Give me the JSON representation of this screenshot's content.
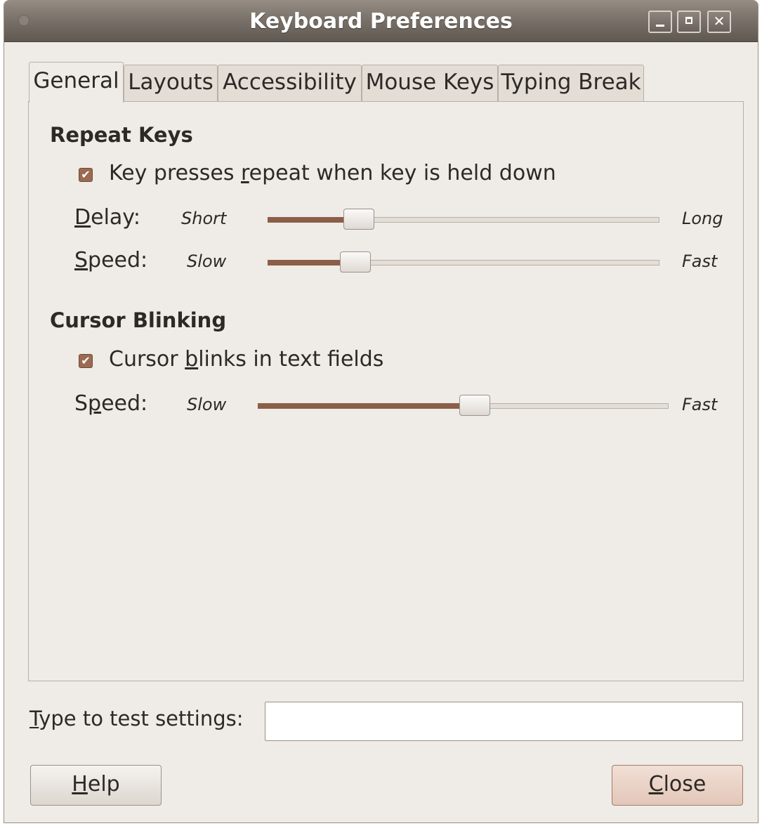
{
  "window": {
    "title": "Keyboard Preferences",
    "buttons": {
      "minimize": "minimize-icon",
      "maximize": "maximize-icon",
      "close": "close-icon"
    }
  },
  "tabs": [
    {
      "label": "General",
      "active": true
    },
    {
      "label": "Layouts",
      "active": false
    },
    {
      "label": "Accessibility",
      "active": false
    },
    {
      "label": "Mouse Keys",
      "active": false
    },
    {
      "label": "Typing Break",
      "active": false
    }
  ],
  "repeat_keys": {
    "heading": "Repeat Keys",
    "checkbox": {
      "pre": "Key presses ",
      "mnemonic": "r",
      "post": "epeat when key is held down",
      "checked": true
    },
    "delay": {
      "label_mnemonic": "D",
      "label_rest": "elay:",
      "min": "Short",
      "max": "Long",
      "value": 0.21
    },
    "speed": {
      "label_mnemonic": "S",
      "label_rest": "peed:",
      "min": "Slow",
      "max": "Fast",
      "value": 0.2
    }
  },
  "cursor_blinking": {
    "heading": "Cursor Blinking",
    "checkbox": {
      "pre": "Cursor ",
      "mnemonic": "b",
      "post": "links in text fields",
      "checked": true
    },
    "speed": {
      "label_pre": "S",
      "label_mnemonic": "p",
      "label_rest": "eed:",
      "min": "Slow",
      "max": "Fast",
      "value": 0.53
    }
  },
  "test": {
    "label_mnemonic": "T",
    "label_rest": "ype to test settings:",
    "value": ""
  },
  "buttons": {
    "help": {
      "mnemonic": "H",
      "rest": "elp"
    },
    "close": {
      "mnemonic": "C",
      "rest": "lose"
    }
  },
  "colors": {
    "accent": "#8b5e48",
    "checkbox": "#9b6a51",
    "titlebar": "#7a726a"
  }
}
